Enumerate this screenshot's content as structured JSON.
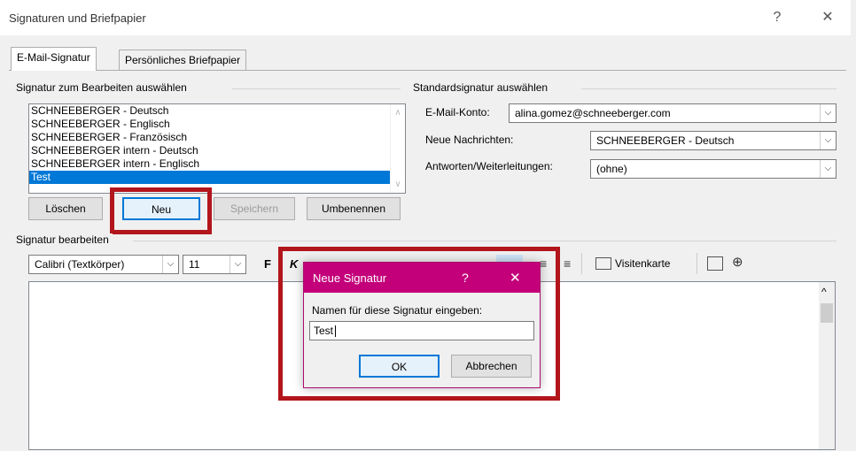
{
  "window": {
    "title": "Signaturen und Briefpapier",
    "help": "?",
    "close": "✕"
  },
  "tabs": [
    {
      "label": "E-Mail-Signatur",
      "active": true
    },
    {
      "label": "Persönliches Briefpapier",
      "active": false
    }
  ],
  "select_group": {
    "label": "Signatur zum Bearbeiten auswählen",
    "items": [
      "SCHNEEBERGER - Deutsch",
      "SCHNEEBERGER - Englisch",
      "SCHNEEBERGER - Französisch",
      "SCHNEEBERGER intern - Deutsch",
      "SCHNEEBERGER intern - Englisch",
      "Test"
    ],
    "selected": "Test",
    "buttons": {
      "delete": "Löschen",
      "new": "Neu",
      "save": "Speichern",
      "rename": "Umbenennen"
    }
  },
  "default_group": {
    "label": "Standardsignatur auswählen",
    "account_label": "E-Mail-Konto:",
    "account_value": "alina.gomez@schneeberger.com",
    "new_messages_label": "Neue Nachrichten:",
    "new_messages_value": "SCHNEEBERGER - Deutsch",
    "replies_label": "Antworten/Weiterleitungen:",
    "replies_value": "(ohne)"
  },
  "edit_group": {
    "label": "Signatur bearbeiten",
    "font": "Calibri (Textkörper)",
    "size": "11",
    "bold": "F",
    "italic": "K",
    "business_card": "Visitenkarte"
  },
  "dialog": {
    "title": "Neue Signatur",
    "help": "?",
    "close": "✕",
    "prompt": "Namen für diese Signatur eingeben:",
    "value": "Test",
    "ok": "OK",
    "cancel": "Abbrechen"
  },
  "colors": {
    "dialog_title_bg": "#c3007a",
    "selection": "#0078d7",
    "highlight_frame": "#b2151b"
  }
}
